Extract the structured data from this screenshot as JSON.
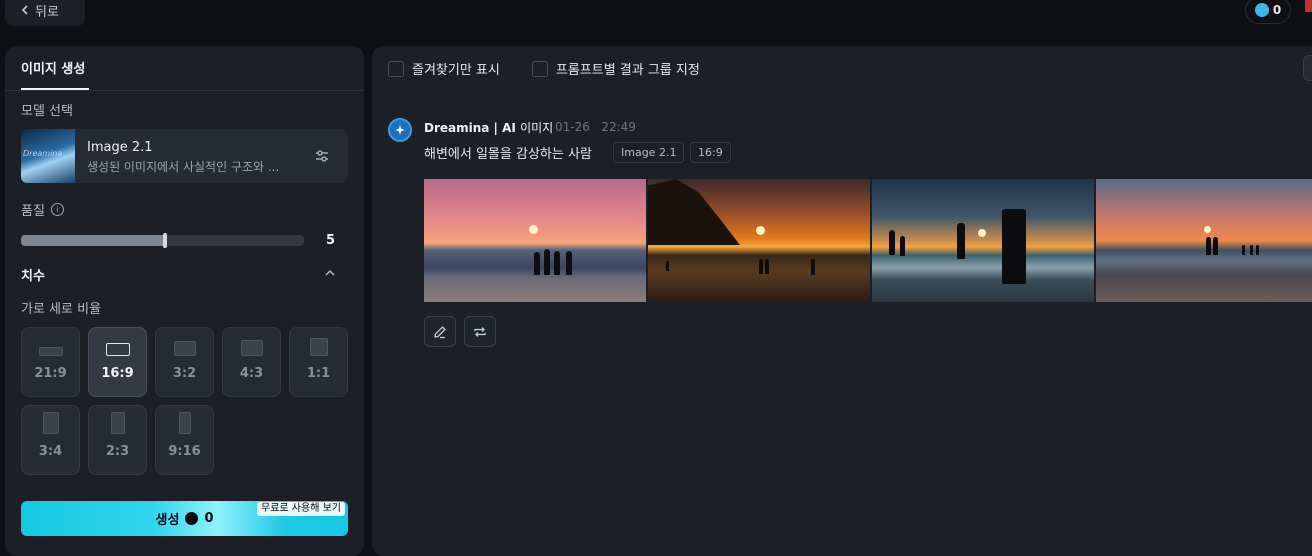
{
  "topbar": {
    "back_label": "뒤로",
    "credits": "0"
  },
  "left_panel": {
    "tab_label": "이미지 생성",
    "model_section_label": "모델 선택",
    "model": {
      "name": "Image 2.1",
      "description": "생성된 이미지에서 사실적인 구조와 ..."
    },
    "quality_label": "품질",
    "quality_value": "5",
    "quality_fraction": 0.5,
    "size_section_label": "치수",
    "aspect_label": "가로 세로 비율",
    "ratios": [
      {
        "label": "21:9"
      },
      {
        "label": "16:9",
        "active": true
      },
      {
        "label": "3:2"
      },
      {
        "label": "4:3"
      },
      {
        "label": "1:1"
      },
      {
        "label": "3:4"
      },
      {
        "label": "2:3"
      },
      {
        "label": "9:16"
      }
    ],
    "generate": {
      "label": "생성",
      "cost": "0",
      "free_badge": "무료로 사용해 보기"
    }
  },
  "right_panel": {
    "filters": {
      "favorites_only": "즐겨찾기만 표시",
      "group_by_prompt": "프롬프트별 결과 그룹 지정"
    },
    "result": {
      "author": "Dreamina | AI",
      "author_suffix": "이미지",
      "date": "01-26",
      "time": "22:49",
      "prompt": "해변에서 일몰을 감상하는 사람",
      "tags": [
        "Image 2.1",
        "16:9"
      ],
      "images": [
        "sunset-beach-1",
        "sunset-beach-2",
        "sunset-beach-3",
        "sunset-beach-4"
      ]
    }
  },
  "colors": {
    "accent": "#16c8e3",
    "panel_bg": "#1c1f25",
    "page_bg": "#0f1014"
  }
}
